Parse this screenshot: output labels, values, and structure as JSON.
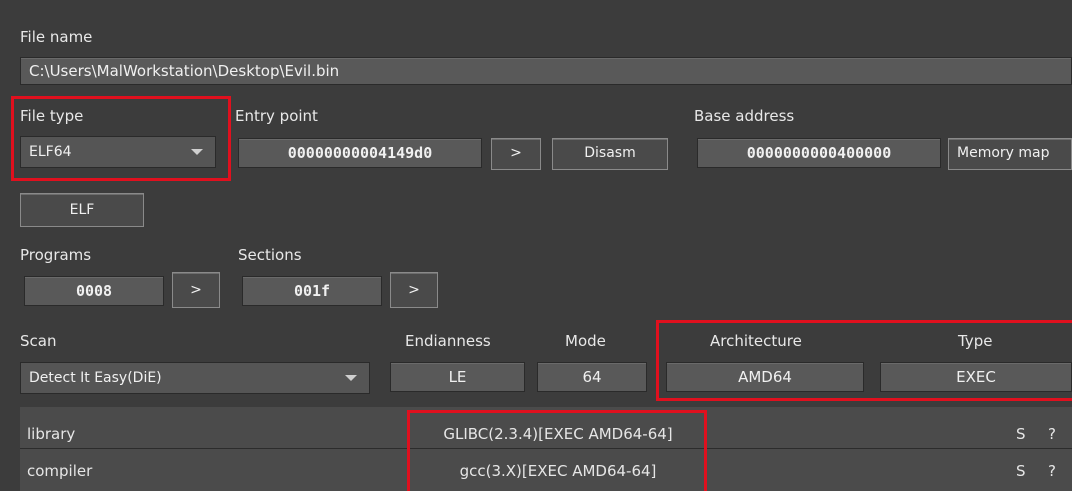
{
  "file_name": {
    "label": "File name",
    "value": "C:\\Users\\MalWorkstation\\Desktop\\Evil.bin"
  },
  "file_type": {
    "label": "File type",
    "value": "ELF64"
  },
  "entry_point": {
    "label": "Entry point",
    "value": "00000000004149d0",
    "go": ">",
    "disasm": "Disasm"
  },
  "base_address": {
    "label": "Base address",
    "value": "0000000000400000",
    "memory_map": "Memory map"
  },
  "elf_button": "ELF",
  "programs": {
    "label": "Programs",
    "value": "0008",
    "go": ">"
  },
  "sections": {
    "label": "Sections",
    "value": "001f",
    "go": ">"
  },
  "scan": {
    "label": "Scan",
    "value": "Detect It Easy(DiE)"
  },
  "endianness": {
    "label": "Endianness",
    "value": "LE"
  },
  "mode": {
    "label": "Mode",
    "value": "64"
  },
  "architecture": {
    "label": "Architecture",
    "value": "AMD64"
  },
  "type": {
    "label": "Type",
    "value": "EXEC"
  },
  "results": [
    {
      "name": "library",
      "value": "GLIBC(2.3.4)[EXEC AMD64-64]",
      "s": "S",
      "q": "?"
    },
    {
      "name": "compiler",
      "value": "gcc(3.X)[EXEC AMD64-64]",
      "s": "S",
      "q": "?"
    }
  ],
  "colors": {
    "highlight": "#e0101e",
    "background": "#3c3c3c"
  }
}
